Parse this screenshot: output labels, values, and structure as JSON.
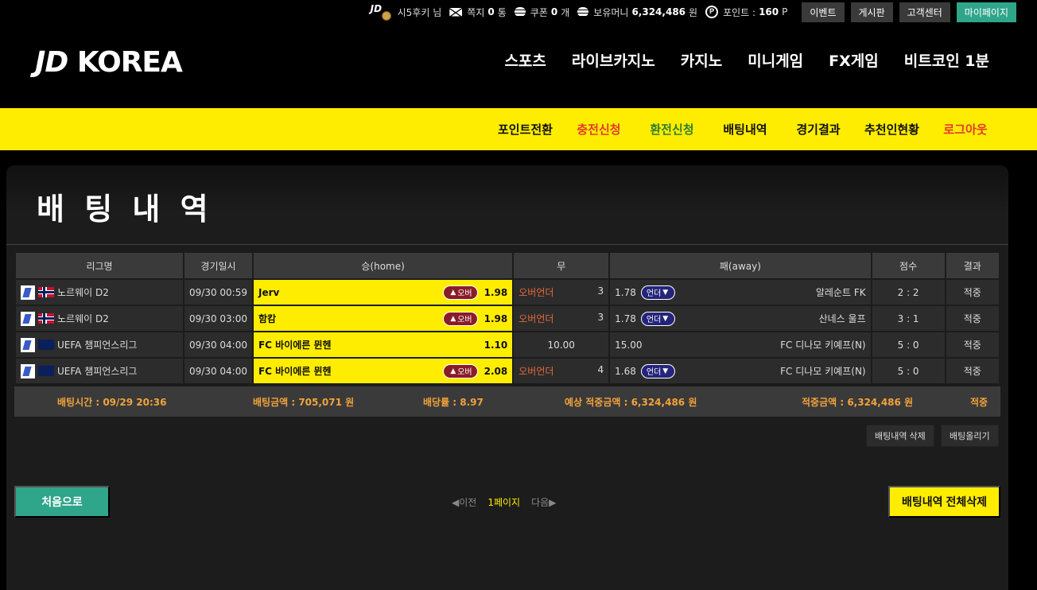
{
  "topbar": {
    "user": "시5후키",
    "user_suffix": "님",
    "message_label": "쪽지",
    "message_count": "0",
    "message_unit": "통",
    "coupon_label": "쿠폰",
    "coupon_count": "0",
    "coupon_unit": "개",
    "money_label": "보유머니",
    "money_value": "6,324,486",
    "money_unit": "원",
    "point_label": "포인트 :",
    "point_value": "160",
    "point_unit": "P",
    "buttons": [
      "이벤트",
      "게시판",
      "고객센터",
      "마이페이지"
    ]
  },
  "logo": {
    "text_jd": "JD",
    "text_korea": "KOREA"
  },
  "mainnav": [
    "스포츠",
    "라이브카지노",
    "카지노",
    "미니게임",
    "FX게임",
    "비트코인 1분"
  ],
  "subnav": [
    "포인트전환",
    "충전신청",
    "환전신청",
    "배팅내역",
    "경기결과",
    "추천인현황",
    "로그아웃"
  ],
  "page": {
    "title": "배 팅 내 역"
  },
  "table": {
    "headers": [
      "리그명",
      "경기일시",
      "승(home)",
      "무",
      "패(away)",
      "점수",
      "결과"
    ],
    "rows": [
      {
        "league": "노르웨이 D2",
        "date": "09/30 00:59",
        "home": "Jerv",
        "home_badge": "오버",
        "home_odds": "1.98",
        "draw_label": "오버언더",
        "draw_value": "3",
        "away_odds": "1.78",
        "away_badge": "언더",
        "away": "알레순트 FK",
        "score": "2 : 2",
        "result": "적중"
      },
      {
        "league": "노르웨이 D2",
        "date": "09/30 03:00",
        "home": "함캄",
        "home_badge": "오버",
        "home_odds": "1.98",
        "draw_label": "오버언더",
        "draw_value": "3",
        "away_odds": "1.78",
        "away_badge": "언더",
        "away": "산네스 울프",
        "score": "3 : 1",
        "result": "적중"
      },
      {
        "league": "UEFA 챔피언스리그",
        "date": "09/30 04:00",
        "home": "FC 바이에른 뮌헨",
        "home_badge": "",
        "home_odds": "1.10",
        "draw_label": "",
        "draw_value": "10.00",
        "away_odds": "15.00",
        "away_badge": "",
        "away": "FC 디나모 키예프(N)",
        "score": "5 : 0",
        "result": "적중"
      },
      {
        "league": "UEFA 챔피언스리그",
        "date": "09/30 04:00",
        "home": "FC 바이에른 뮌헨",
        "home_badge": "오버",
        "home_odds": "2.08",
        "draw_label": "오버언더",
        "draw_value": "4",
        "away_odds": "1.68",
        "away_badge": "언더",
        "away": "FC 디나모 키예프(N)",
        "score": "5 : 0",
        "result": "적중"
      }
    ]
  },
  "summary": {
    "bet_time": "배팅시간 : 09/29 20:36",
    "bet_amount": "배팅금액 : 705,071 원",
    "odds": "배당률 : 8.97",
    "expected": "예상 적중금액 : 6,324,486 원",
    "win_amount": "적중금액 : 6,324,486 원",
    "status": "적중"
  },
  "actions": {
    "delete_history": "배팅내역 삭제",
    "upload_bet": "배팅올리기",
    "home": "처음으로",
    "prev": "◀이전",
    "current_page": "1페이지",
    "next": "다음▶",
    "delete_all": "배팅내역 전체삭제"
  },
  "colors": {
    "accent_yellow": "#ffed00",
    "accent_green": "#2fa58a",
    "over_red": "#8a1c28",
    "under_blue": "#24257a",
    "summary_orange": "#f2a23b"
  }
}
